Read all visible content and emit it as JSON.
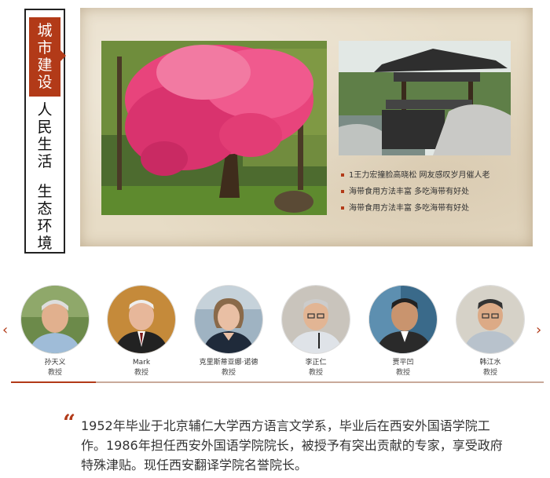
{
  "tabs": [
    {
      "chars": [
        "城",
        "市",
        "建",
        "设"
      ],
      "active": true
    },
    {
      "chars": [
        "人",
        "民",
        "生",
        "活"
      ],
      "active": false
    },
    {
      "chars": [
        "生",
        "态",
        "环",
        "境"
      ],
      "active": false
    }
  ],
  "news": [
    "1王力宏撞脸高晓松 网友感叹岁月催人老",
    "海带食用方法丰富 多吃海带有好处",
    "海带食用方法丰富 多吃海带有好处"
  ],
  "people": [
    {
      "name": "孙天义",
      "title": "教授"
    },
    {
      "name": "Mark",
      "title": "教授"
    },
    {
      "name": "克里斯蒂亚娜·诺德",
      "title": "教授"
    },
    {
      "name": "李正仁",
      "title": "教授"
    },
    {
      "name": "贾平凹",
      "title": "教授"
    },
    {
      "name": "韩江水",
      "title": "教授"
    }
  ],
  "carousel": {
    "prev": "‹",
    "next": "›"
  },
  "quote": {
    "mark": "“",
    "text": "1952年毕业于北京辅仁大学西方语言文学系，毕业后在西安外国语学院工作。1986年担任西安外国语学院院长，被授予有突出贡献的专家，享受政府特殊津贴。现任西安翻译学院名誉院长。"
  },
  "colors": {
    "accent": "#b23a18",
    "parchment": "#e7dcc6"
  }
}
